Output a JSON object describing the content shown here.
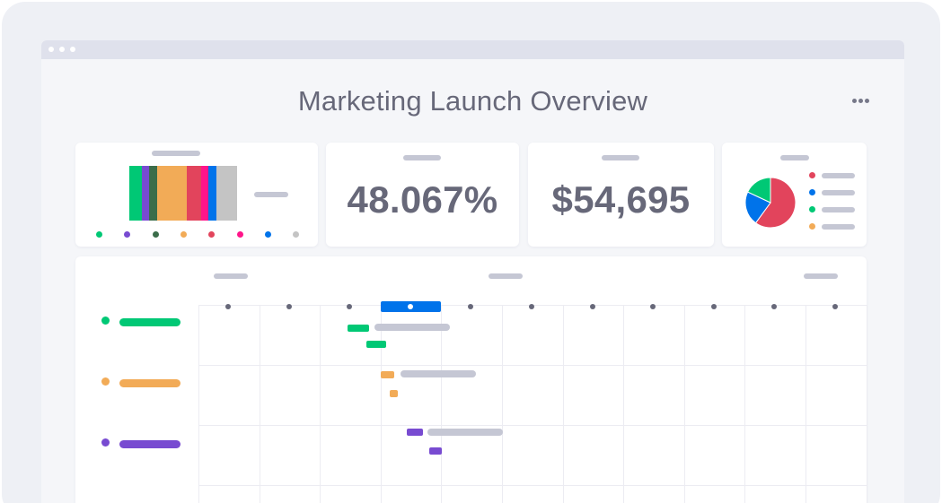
{
  "page": {
    "title": "Marketing Launch Overview",
    "more_icon": "more-horizontal-icon"
  },
  "colors": {
    "green": "#00c875",
    "purple": "#784bd1",
    "dark_green": "#3b6d4a",
    "orange": "#f2ab57",
    "red": "#e2445c",
    "pink": "#ff158a",
    "blue": "#0073ea",
    "gray": "#c4c4c4",
    "text": "#676879",
    "placeholder": "#c5c7d4"
  },
  "kpis": [
    {
      "value": "48.067%"
    },
    {
      "value": "$54,695"
    }
  ],
  "status_bar": {
    "segments": [
      {
        "color": "#00c875",
        "share": 0.115
      },
      {
        "color": "#784bd1",
        "share": 0.07
      },
      {
        "color": "#3b6d4a",
        "share": 0.07
      },
      {
        "color": "#f2ab57",
        "share": 0.275
      },
      {
        "color": "#e2445c",
        "share": 0.135
      },
      {
        "color": "#ff158a",
        "share": 0.07
      },
      {
        "color": "#0073ea",
        "share": 0.07
      },
      {
        "color": "#c4c4c4",
        "share": 0.195
      }
    ],
    "legend_colors": [
      "#00c875",
      "#784bd1",
      "#3b6d4a",
      "#f2ab57",
      "#e2445c",
      "#ff158a",
      "#0073ea",
      "#c4c4c4"
    ]
  },
  "pie": {
    "slices": [
      {
        "color": "#e2445c",
        "share": 0.6
      },
      {
        "color": "#0073ea",
        "share": 0.22
      },
      {
        "color": "#00c875",
        "share": 0.18
      }
    ],
    "legend_colors": [
      "#e2445c",
      "#0073ea",
      "#00c875",
      "#f2ab57"
    ]
  },
  "timeline": {
    "columns": 11,
    "highlighted_column": 3,
    "highlight_color": "#0073ea",
    "groups": [
      {
        "color": "#00c875"
      },
      {
        "color": "#f2ab57"
      },
      {
        "color": "#784bd1"
      }
    ]
  }
}
